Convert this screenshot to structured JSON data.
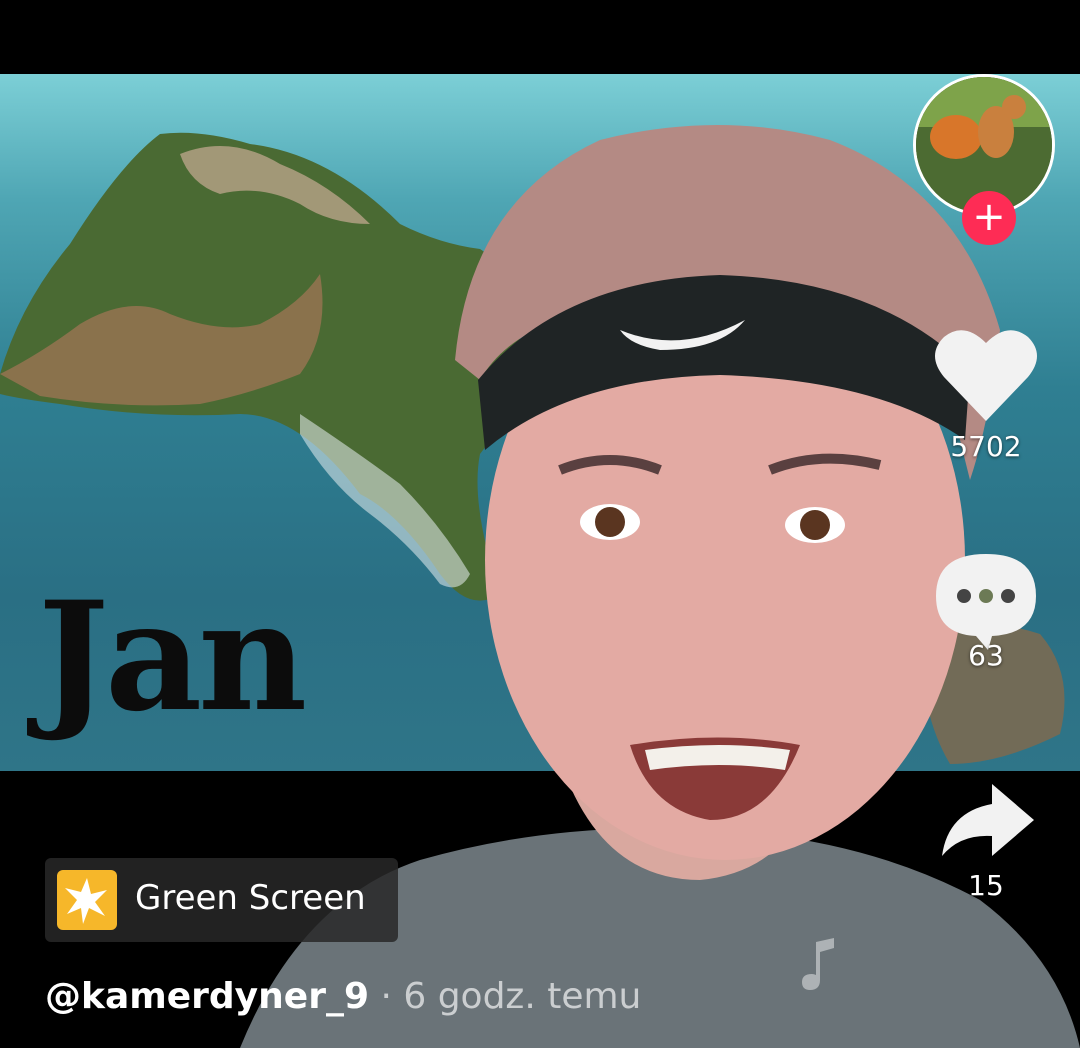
{
  "video": {
    "overlay_text": "Jan"
  },
  "side_actions": {
    "likes": "5702",
    "comments": "63",
    "shares": "15",
    "follow_symbol": "+"
  },
  "effect": {
    "label": "Green Screen",
    "icon": "sparkle-icon"
  },
  "post": {
    "username": "@kamerdyner_9",
    "separator": "·",
    "time": "6 godz. temu"
  },
  "colors": {
    "follow": "#fe2c55",
    "effect_icon": "#f6b72a"
  }
}
